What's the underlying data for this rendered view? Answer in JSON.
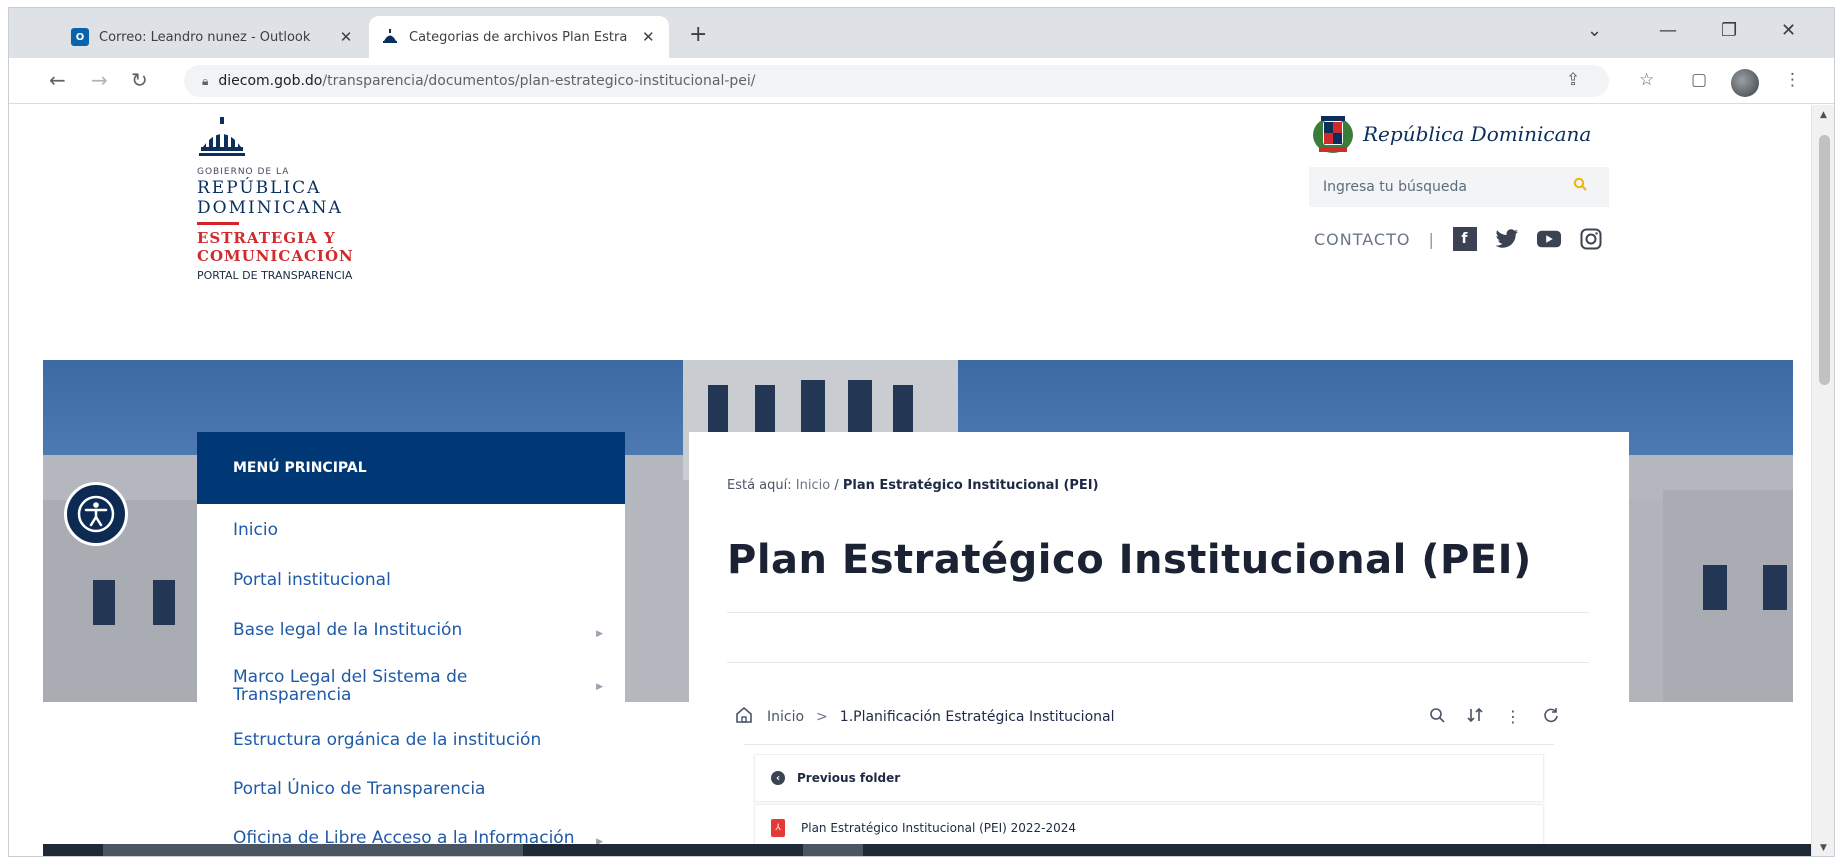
{
  "browser": {
    "tabs": [
      {
        "title": "Correo: Leandro nunez - Outlook",
        "close": "✕"
      },
      {
        "title": "Categorias de archivos Plan Estra",
        "close": "✕"
      }
    ],
    "new_tab": "+",
    "url_domain": "diecom.gob.do",
    "url_path": "/transparencia/documentos/plan-estrategico-institucional-pei/"
  },
  "header": {
    "logo": {
      "gov": "GOBIERNO DE LA",
      "country": "REPÚBLICA DOMINICANA",
      "unit_line1": "ESTRATEGIA Y",
      "unit_line2": "COMUNICACIÓN",
      "portal": "PORTAL DE TRANSPARENCIA"
    },
    "brand": "República Dominicana",
    "search_placeholder": "Ingresa tu búsqueda",
    "contact": "CONTACTO",
    "separator": "|"
  },
  "sidebar": {
    "title": "MENÚ PRINCIPAL",
    "items": [
      {
        "label": "Inicio"
      },
      {
        "label": "Portal institucional"
      },
      {
        "label": "Base legal de la Institución"
      },
      {
        "label": "Marco Legal del Sistema de Transparencia"
      },
      {
        "label": "Estructura orgánica de la institución"
      },
      {
        "label": "Portal Único de Transparencia"
      },
      {
        "label": "Oficina de Libre Acceso a la Información"
      }
    ]
  },
  "main": {
    "breadcrumb": {
      "prefix": "Está aquí:",
      "home": "Inicio",
      "sep": "/",
      "current": "Plan Estratégico Institucional (PEI)"
    },
    "title": "Plan Estratégico Institucional (PEI)",
    "file_manager": {
      "home": "Inicio",
      "sep": ">",
      "folder": "1.Planificación Estratégica Institucional",
      "rows": [
        {
          "label": "Previous folder"
        },
        {
          "label": "Plan Estratégico Institucional (PEI) 2022-2024"
        }
      ]
    }
  },
  "colors": {
    "primary": "#003876",
    "accent_red": "#cf2a2c",
    "link": "#1e5aa8",
    "facebook": "#3b4352",
    "search_icon": "#f0b400"
  }
}
